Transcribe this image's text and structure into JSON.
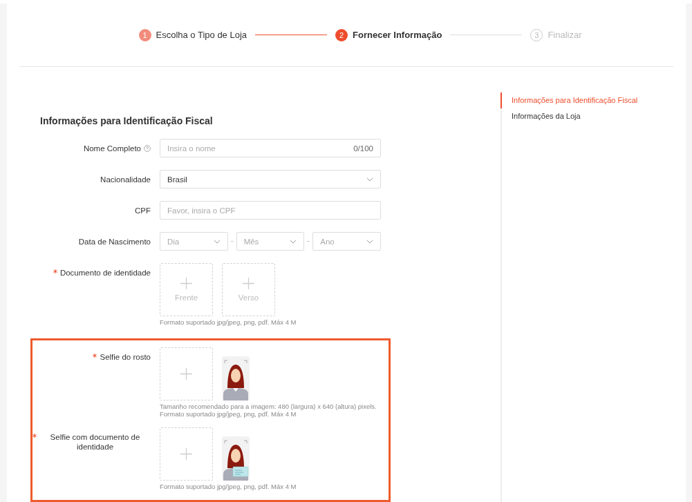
{
  "steps": [
    {
      "number": "1",
      "label": "Escolha o Tipo de Loja",
      "completed": true,
      "selected": false
    },
    {
      "number": "2",
      "label": "Fornecer Informação",
      "completed": false,
      "selected": true
    },
    {
      "number": "3",
      "label": "Finalizar",
      "completed": false,
      "selected": false
    }
  ],
  "section_title": "Informações para Identificação Fiscal",
  "fields": [
    {
      "kind": "text",
      "label": "Nome Completo",
      "help": true,
      "required": false,
      "placeholder": "Insira o nome",
      "counter": "0/100"
    },
    {
      "kind": "select",
      "label": "Nacionalidade",
      "required": false,
      "value": "Brasil"
    },
    {
      "kind": "text",
      "label": "CPF",
      "required": false,
      "placeholder": "Favor, insira o CPF"
    },
    {
      "kind": "date",
      "label": "Data de Nascimento",
      "required": false,
      "parts": [
        {
          "placeholder": "Dia"
        },
        {
          "placeholder": "Mês"
        },
        {
          "placeholder": "Ano"
        }
      ]
    },
    {
      "kind": "upload",
      "label": "Documento de identidade",
      "required": true,
      "slot_labels": [
        "Frente",
        "Verso"
      ],
      "hints": [
        "Formato suportado jpg/jpeg, png, pdf. Máx 4 M"
      ]
    }
  ],
  "highlighted_fields": [
    {
      "kind": "upload",
      "label": "Selfie do rosto",
      "required": true,
      "example": {
        "kind": "selfie"
      },
      "hints": [
        "Tamanho recomendado para a imagem: 480 (largura) x 640 (altura) pixels.",
        "Formato suportado jpg/jpeg, png, pdf. Máx 4 M"
      ]
    },
    {
      "kind": "upload",
      "label": "Selfie com documento de identidade",
      "required": true,
      "example": {
        "kind": "selfie_with_card"
      },
      "hints": [
        "Formato suportado jpg/jpeg, png, pdf. Máx 4 M"
      ]
    }
  ],
  "side_nav": [
    {
      "label": "Informações para Identificação Fiscal",
      "selected": true
    },
    {
      "label": "Informações da Loja",
      "selected": false
    }
  ]
}
